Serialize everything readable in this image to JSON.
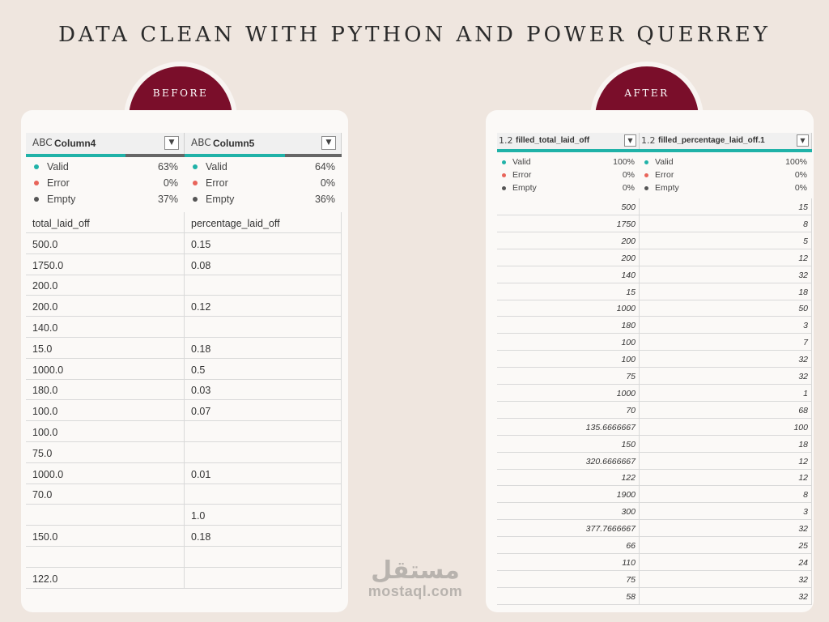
{
  "title": "DATA CLEAN WITH PYTHON AND POWER QUERREY",
  "before": {
    "badge": "BEFORE",
    "columns": [
      {
        "type_icon": "ABC",
        "name": "Column4",
        "valid_pct": 0.63,
        "stats": [
          {
            "label": "Valid",
            "value": "63%",
            "color": "#20b2a8"
          },
          {
            "label": "Error",
            "value": "0%",
            "color": "#e8645a"
          },
          {
            "label": "Empty",
            "value": "37%",
            "color": "#555555"
          }
        ]
      },
      {
        "type_icon": "ABC",
        "name": "Column5",
        "valid_pct": 0.64,
        "stats": [
          {
            "label": "Valid",
            "value": "64%",
            "color": "#20b2a8"
          },
          {
            "label": "Error",
            "value": "0%",
            "color": "#e8645a"
          },
          {
            "label": "Empty",
            "value": "36%",
            "color": "#555555"
          }
        ]
      }
    ],
    "rows": [
      [
        "total_laid_off",
        "percentage_laid_off"
      ],
      [
        "500.0",
        "0.15"
      ],
      [
        "1750.0",
        "0.08"
      ],
      [
        "200.0",
        ""
      ],
      [
        "200.0",
        "0.12"
      ],
      [
        "140.0",
        ""
      ],
      [
        "15.0",
        "0.18"
      ],
      [
        "1000.0",
        "0.5"
      ],
      [
        "180.0",
        "0.03"
      ],
      [
        "100.0",
        "0.07"
      ],
      [
        "100.0",
        ""
      ],
      [
        "75.0",
        ""
      ],
      [
        "1000.0",
        "0.01"
      ],
      [
        "70.0",
        ""
      ],
      [
        "",
        "1.0"
      ],
      [
        "150.0",
        "0.18"
      ],
      [
        "",
        ""
      ],
      [
        "122.0",
        ""
      ]
    ]
  },
  "after": {
    "badge": "AFTER",
    "columns": [
      {
        "type_icon": "1.2",
        "name": "filled_total_laid_off",
        "valid_pct": 1.0,
        "stats": [
          {
            "label": "Valid",
            "value": "100%",
            "color": "#20b2a8"
          },
          {
            "label": "Error",
            "value": "0%",
            "color": "#e8645a"
          },
          {
            "label": "Empty",
            "value": "0%",
            "color": "#555555"
          }
        ]
      },
      {
        "type_icon": "1.2",
        "name": "filled_percentage_laid_off.1",
        "valid_pct": 1.0,
        "stats": [
          {
            "label": "Valid",
            "value": "100%",
            "color": "#20b2a8"
          },
          {
            "label": "Error",
            "value": "0%",
            "color": "#e8645a"
          },
          {
            "label": "Empty",
            "value": "0%",
            "color": "#555555"
          }
        ]
      }
    ],
    "rows": [
      [
        "500",
        "15"
      ],
      [
        "1750",
        "8"
      ],
      [
        "200",
        "5"
      ],
      [
        "200",
        "12"
      ],
      [
        "140",
        "32"
      ],
      [
        "15",
        "18"
      ],
      [
        "1000",
        "50"
      ],
      [
        "180",
        "3"
      ],
      [
        "100",
        "7"
      ],
      [
        "100",
        "32"
      ],
      [
        "75",
        "32"
      ],
      [
        "1000",
        "1"
      ],
      [
        "70",
        "68"
      ],
      [
        "135.6666667",
        "100"
      ],
      [
        "150",
        "18"
      ],
      [
        "320.6666667",
        "12"
      ],
      [
        "122",
        "12"
      ],
      [
        "1900",
        "8"
      ],
      [
        "300",
        "3"
      ],
      [
        "377.7666667",
        "32"
      ],
      [
        "66",
        "25"
      ],
      [
        "110",
        "24"
      ],
      [
        "75",
        "32"
      ],
      [
        "58",
        "32"
      ]
    ]
  },
  "watermark": {
    "arabic": "مستقل",
    "latin": "mostaql.com"
  }
}
